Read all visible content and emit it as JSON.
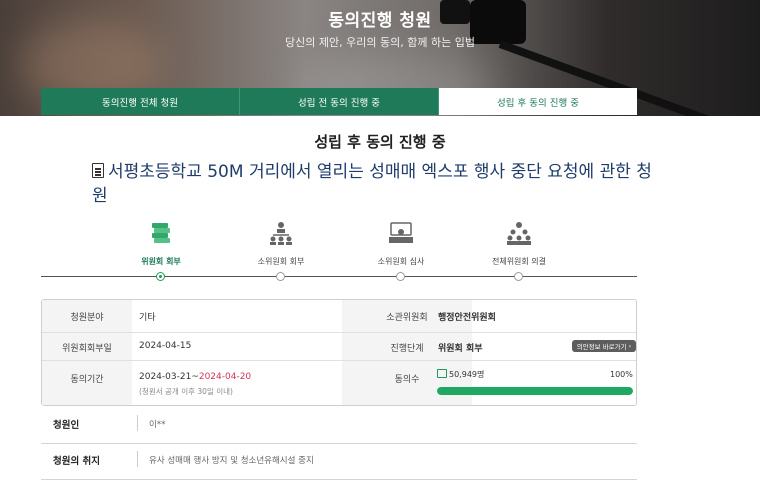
{
  "hero": {
    "title": "동의진행 청원",
    "subtitle": "당신의 제안, 우리의 동의, 함께 하는 입법"
  },
  "tabs": [
    {
      "label": "동의진행 전체 청원",
      "active": false
    },
    {
      "label": "성립 전 동의 진행 중",
      "active": false
    },
    {
      "label": "성립 후 동의 진행 중",
      "active": true
    }
  ],
  "section_title": "성립 후 동의 진행 중",
  "petition": {
    "icon": "document-icon",
    "title": "서평초등학교 50M 거리에서 열리는 성매매 엑스포 행사 중단 요청에 관한 청원"
  },
  "steps": [
    {
      "label": "위원회 회부",
      "icon": "committee-icon",
      "active": true
    },
    {
      "label": "소위원회 회부",
      "icon": "subcommittee-icon",
      "active": false
    },
    {
      "label": "소위원회 심사",
      "icon": "review-icon",
      "active": false
    },
    {
      "label": "전체위원회 의결",
      "icon": "plenary-icon",
      "active": false
    }
  ],
  "info": {
    "field_label": "청원분야",
    "field_value": "기타",
    "committee_label": "소관위원회",
    "committee_value": "행정안전위원회",
    "referral_date_label": "위원회회부일",
    "referral_date_value": "2024-04-15",
    "stage_label": "진행단계",
    "stage_value": "위원회 회부",
    "shortcut_button": "의안정보 바로가기",
    "period_label": "동의기간",
    "period_start": "2024-03-21",
    "period_sep": "~",
    "period_end": "2024-04-20",
    "period_note": "(청원서 공개 이후 30일 이내)",
    "agree_label": "동의수",
    "agree_count": "50,949명",
    "agree_percent_text": "100%",
    "agree_percent": 100
  },
  "rows": [
    {
      "label": "청원인",
      "value": "이**"
    },
    {
      "label": "청원의 취지",
      "value": "유사 성매매 행사 방지 및 청소년유해시설 중지"
    }
  ],
  "colors": {
    "brand_green": "#1f7a5a",
    "progress_green": "#1fa864",
    "title_blue": "#1f3d6b",
    "date_red": "#d6335a"
  }
}
